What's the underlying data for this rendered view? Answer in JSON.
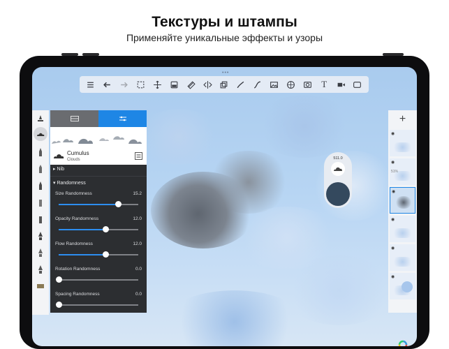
{
  "headline": "Текстуры и штампы",
  "subheadline": "Применяйте уникальные эффекты и узоры",
  "toolbar": {
    "icons": [
      "list-icon",
      "undo-icon",
      "redo-icon",
      "select-icon",
      "move-icon",
      "fill-icon",
      "eraser-icon",
      "symmetry-icon",
      "copy-icon",
      "ruler-icon",
      "curve-icon",
      "image-icon",
      "grid-icon",
      "stamp-icon",
      "text-icon",
      "video-icon",
      "fullscreen-icon"
    ],
    "text_tool_glyph": "T"
  },
  "brush": {
    "name": "Cumulus",
    "category": "Clouds"
  },
  "sections": {
    "nib": "Nib",
    "randomness": "Randomness"
  },
  "sliders": [
    {
      "label": "Size Randomness",
      "value": "15.2",
      "position": 0.75
    },
    {
      "label": "Opacity Randomness",
      "value": "12.0",
      "position": 0.59
    },
    {
      "label": "Flow Randomness",
      "value": "12.0",
      "position": 0.59
    },
    {
      "label": "Rotation Randomness",
      "value": "0.0",
      "position": 0.0
    },
    {
      "label": "Spacing Randomness",
      "value": "0.0",
      "position": 0.0
    }
  ],
  "puck": {
    "size_value": "511.0",
    "color": "#34495e"
  },
  "layers": {
    "add_label": "+",
    "items": [
      {
        "eye": "◉",
        "opacity": ""
      },
      {
        "eye": "◉",
        "opacity": "51%"
      },
      {
        "eye": "◉",
        "opacity": "",
        "selected": true
      },
      {
        "eye": "◉",
        "opacity": ""
      },
      {
        "eye": "◉",
        "opacity": ""
      },
      {
        "eye": "◉",
        "opacity": ""
      }
    ]
  },
  "colors": {
    "accent": "#1e86e5",
    "panel": "#2c2e31",
    "sky": "#b7d5f3"
  }
}
